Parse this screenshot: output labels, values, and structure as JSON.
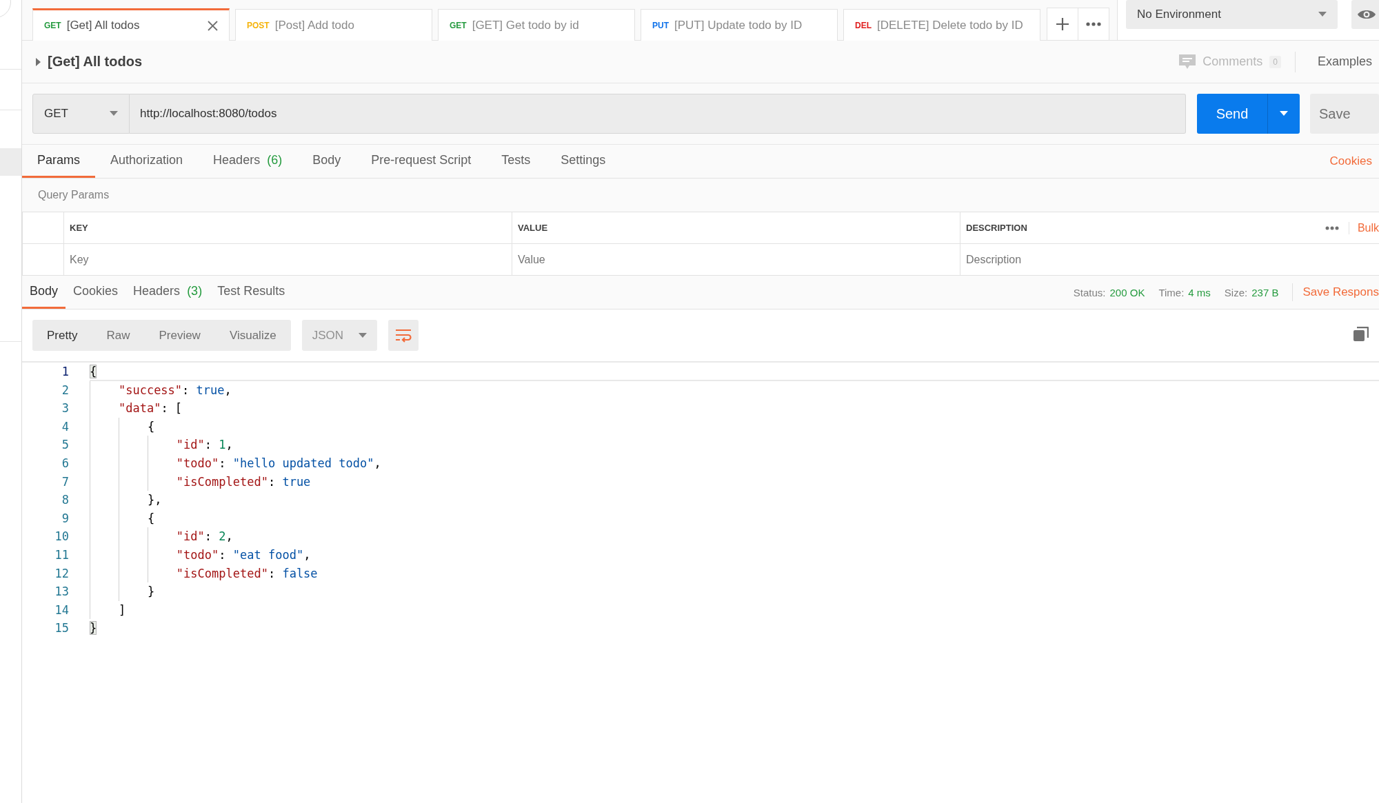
{
  "tabs": [
    {
      "method": "GET",
      "color": "#259b3f",
      "title": "[Get] All todos",
      "selected": true
    },
    {
      "method": "POST",
      "color": "#f5b30b",
      "title": "[Post] Add todo",
      "selected": false
    },
    {
      "method": "GET",
      "color": "#259b3f",
      "title": "[GET] Get todo by id",
      "selected": false
    },
    {
      "method": "PUT",
      "color": "#0f72ea",
      "title": "[PUT] Update todo by ID",
      "selected": false
    },
    {
      "method": "DEL",
      "color": "#e01d1d",
      "title": "[DELETE] Delete todo by ID",
      "selected": false
    }
  ],
  "environment": {
    "label": "No Environment"
  },
  "request": {
    "title": "[Get] All todos",
    "comments": {
      "label": "Comments",
      "count": "0"
    },
    "examples": "Examples",
    "method": "GET",
    "url": "http://localhost:8080/todos",
    "send": "Send",
    "save": "Save"
  },
  "request_tabs": [
    {
      "label": "Params",
      "selected": true
    },
    {
      "label": "Authorization",
      "selected": false
    },
    {
      "label": "Headers",
      "count": "(6)",
      "selected": false
    },
    {
      "label": "Body",
      "selected": false
    },
    {
      "label": "Pre-request Script",
      "selected": false
    },
    {
      "label": "Tests",
      "selected": false
    },
    {
      "label": "Settings",
      "selected": false
    }
  ],
  "cookies_link": "Cookies",
  "query_params": {
    "title": "Query Params",
    "columns": [
      "KEY",
      "VALUE",
      "DESCRIPTION"
    ],
    "placeholders": [
      "Key",
      "Value",
      "Description"
    ],
    "bulk": "Bulk"
  },
  "response": {
    "tabs": [
      {
        "label": "Body",
        "selected": true
      },
      {
        "label": "Cookies",
        "selected": false
      },
      {
        "label": "Headers",
        "count": "(3)",
        "selected": false
      },
      {
        "label": "Test Results",
        "selected": false
      }
    ],
    "status": [
      {
        "label": "Status:",
        "value": "200 OK"
      },
      {
        "label": "Time:",
        "value": "4 ms"
      },
      {
        "label": "Size:",
        "value": "237 B"
      }
    ],
    "save_response": "Save Respons",
    "views": [
      {
        "label": "Pretty",
        "selected": true
      },
      {
        "label": "Raw",
        "selected": false
      },
      {
        "label": "Preview",
        "selected": false
      },
      {
        "label": "Visualize",
        "selected": false
      }
    ],
    "format": "JSON",
    "wrap_on": true,
    "lines": [
      {
        "num": "1",
        "active": true,
        "bracket_match": true,
        "tokens": [
          {
            "kind": "punct",
            "text": "{"
          }
        ]
      },
      {
        "num": "2",
        "active": false,
        "bracket_match": false,
        "tokens": [
          {
            "kind": "key",
            "text": "    \"success\""
          },
          {
            "kind": "punct",
            "text": ": "
          },
          {
            "kind": "bool",
            "text": "true"
          },
          {
            "kind": "punct",
            "text": ","
          }
        ]
      },
      {
        "num": "3",
        "active": false,
        "bracket_match": false,
        "tokens": [
          {
            "kind": "key",
            "text": "    \"data\""
          },
          {
            "kind": "punct",
            "text": ": ["
          }
        ]
      },
      {
        "num": "4",
        "active": false,
        "bracket_match": false,
        "tokens": [
          {
            "kind": "punct",
            "text": "        {"
          }
        ]
      },
      {
        "num": "5",
        "active": false,
        "bracket_match": false,
        "tokens": [
          {
            "kind": "key",
            "text": "            \"id\""
          },
          {
            "kind": "punct",
            "text": ": "
          },
          {
            "kind": "number",
            "text": "1"
          },
          {
            "kind": "punct",
            "text": ","
          }
        ]
      },
      {
        "num": "6",
        "active": false,
        "bracket_match": false,
        "tokens": [
          {
            "kind": "key",
            "text": "            \"todo\""
          },
          {
            "kind": "punct",
            "text": ": "
          },
          {
            "kind": "string",
            "text": "\"hello updated todo\""
          },
          {
            "kind": "punct",
            "text": ","
          }
        ]
      },
      {
        "num": "7",
        "active": false,
        "bracket_match": false,
        "tokens": [
          {
            "kind": "key",
            "text": "            \"isCompleted\""
          },
          {
            "kind": "punct",
            "text": ": "
          },
          {
            "kind": "bool",
            "text": "true"
          }
        ]
      },
      {
        "num": "8",
        "active": false,
        "bracket_match": false,
        "tokens": [
          {
            "kind": "punct",
            "text": "        },"
          }
        ]
      },
      {
        "num": "9",
        "active": false,
        "bracket_match": false,
        "tokens": [
          {
            "kind": "punct",
            "text": "        {"
          }
        ]
      },
      {
        "num": "10",
        "active": false,
        "bracket_match": false,
        "tokens": [
          {
            "kind": "key",
            "text": "            \"id\""
          },
          {
            "kind": "punct",
            "text": ": "
          },
          {
            "kind": "number",
            "text": "2"
          },
          {
            "kind": "punct",
            "text": ","
          }
        ]
      },
      {
        "num": "11",
        "active": false,
        "bracket_match": false,
        "tokens": [
          {
            "kind": "key",
            "text": "            \"todo\""
          },
          {
            "kind": "punct",
            "text": ": "
          },
          {
            "kind": "string",
            "text": "\"eat food\""
          },
          {
            "kind": "punct",
            "text": ","
          }
        ]
      },
      {
        "num": "12",
        "active": false,
        "bracket_match": false,
        "tokens": [
          {
            "kind": "key",
            "text": "            \"isCompleted\""
          },
          {
            "kind": "punct",
            "text": ": "
          },
          {
            "kind": "bool",
            "text": "false"
          }
        ]
      },
      {
        "num": "13",
        "active": false,
        "bracket_match": false,
        "tokens": [
          {
            "kind": "punct",
            "text": "        }"
          }
        ]
      },
      {
        "num": "14",
        "active": false,
        "bracket_match": false,
        "tokens": [
          {
            "kind": "punct",
            "text": "    ]"
          }
        ]
      },
      {
        "num": "15",
        "active": false,
        "bracket_match": true,
        "tokens": [
          {
            "kind": "punct",
            "text": "}"
          }
        ]
      }
    ]
  }
}
